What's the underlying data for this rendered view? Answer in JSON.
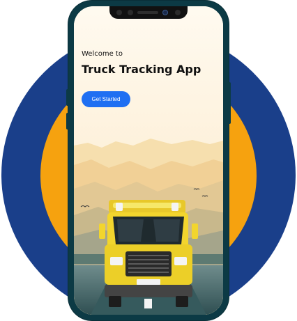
{
  "app": {
    "welcome_text": "Welcome to",
    "title": "Truck Tracking App",
    "cta_label": "Get Started"
  },
  "colors": {
    "outer_circle": "#1a3f8a",
    "inner_circle": "#f6a20f",
    "phone_frame": "#0c3a45",
    "button": "#1f6ff2",
    "truck": "#f2d52e"
  },
  "icons": [
    "truck-illustration",
    "bird-icon"
  ]
}
